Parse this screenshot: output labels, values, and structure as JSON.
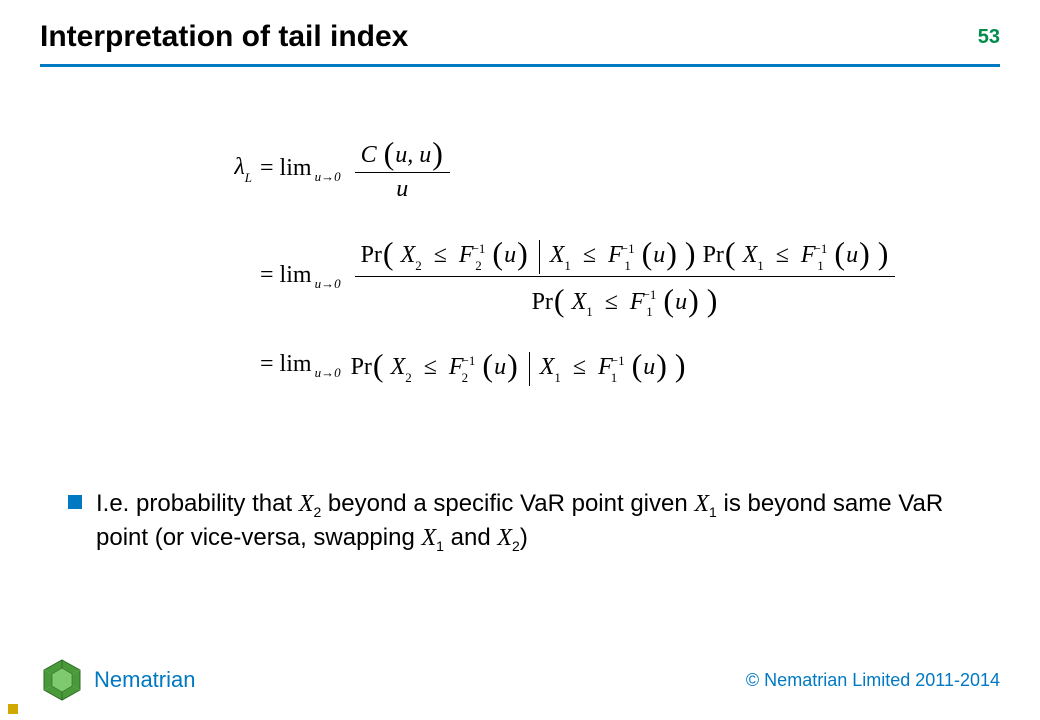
{
  "header": {
    "title": "Interpretation of tail index",
    "page_number": "53"
  },
  "math": {
    "lambda": "λ",
    "lambda_sub": "L",
    "equals": "=",
    "lim": "lim",
    "lim_sub": "u→0",
    "line1_num_C": "C",
    "line1_num_args": "u, u",
    "line1_den": "u",
    "Pr": "Pr",
    "X2": "X",
    "X2_sub": "2",
    "le": "≤",
    "F2": "F",
    "F2_sup": "−1",
    "F2_sub": "2",
    "arg_u": "u",
    "X1": "X",
    "X1_sub": "1",
    "F1": "F",
    "F1_sup": "−1",
    "F1_sub": "1"
  },
  "bullet": {
    "pre": "I.e. probability that ",
    "X2": "X",
    "X2_sub": "2",
    "mid1": " beyond a specific VaR point given ",
    "X1": "X",
    "X1_sub": "1",
    "mid2": " is beyond same VaR point (or vice-versa, swapping ",
    "X1b": "X",
    "X1b_sub": "1",
    "and": " and ",
    "X2b": "X",
    "X2b_sub": "2",
    "tail": ")"
  },
  "footer": {
    "brand": "Nematrian",
    "copyright": "© Nematrian Limited 2011-2014"
  }
}
